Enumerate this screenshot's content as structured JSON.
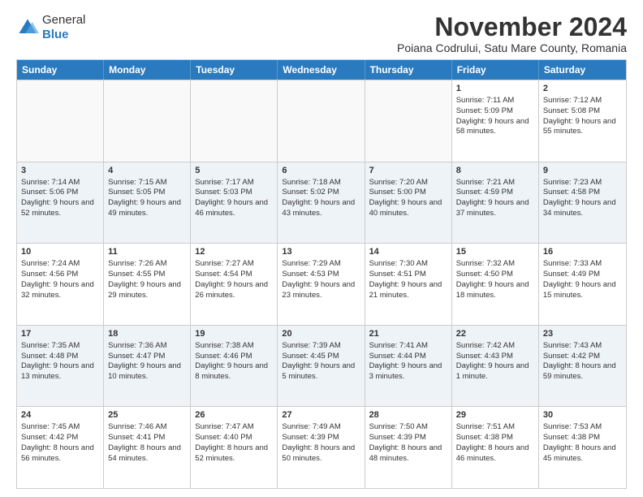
{
  "logo": {
    "general": "General",
    "blue": "Blue"
  },
  "title": "November 2024",
  "subtitle": "Poiana Codrului, Satu Mare County, Romania",
  "headers": [
    "Sunday",
    "Monday",
    "Tuesday",
    "Wednesday",
    "Thursday",
    "Friday",
    "Saturday"
  ],
  "weeks": [
    [
      {
        "day": "",
        "content": ""
      },
      {
        "day": "",
        "content": ""
      },
      {
        "day": "",
        "content": ""
      },
      {
        "day": "",
        "content": ""
      },
      {
        "day": "",
        "content": ""
      },
      {
        "day": "1",
        "content": "Sunrise: 7:11 AM\nSunset: 5:09 PM\nDaylight: 9 hours and 58 minutes."
      },
      {
        "day": "2",
        "content": "Sunrise: 7:12 AM\nSunset: 5:08 PM\nDaylight: 9 hours and 55 minutes."
      }
    ],
    [
      {
        "day": "3",
        "content": "Sunrise: 7:14 AM\nSunset: 5:06 PM\nDaylight: 9 hours and 52 minutes."
      },
      {
        "day": "4",
        "content": "Sunrise: 7:15 AM\nSunset: 5:05 PM\nDaylight: 9 hours and 49 minutes."
      },
      {
        "day": "5",
        "content": "Sunrise: 7:17 AM\nSunset: 5:03 PM\nDaylight: 9 hours and 46 minutes."
      },
      {
        "day": "6",
        "content": "Sunrise: 7:18 AM\nSunset: 5:02 PM\nDaylight: 9 hours and 43 minutes."
      },
      {
        "day": "7",
        "content": "Sunrise: 7:20 AM\nSunset: 5:00 PM\nDaylight: 9 hours and 40 minutes."
      },
      {
        "day": "8",
        "content": "Sunrise: 7:21 AM\nSunset: 4:59 PM\nDaylight: 9 hours and 37 minutes."
      },
      {
        "day": "9",
        "content": "Sunrise: 7:23 AM\nSunset: 4:58 PM\nDaylight: 9 hours and 34 minutes."
      }
    ],
    [
      {
        "day": "10",
        "content": "Sunrise: 7:24 AM\nSunset: 4:56 PM\nDaylight: 9 hours and 32 minutes."
      },
      {
        "day": "11",
        "content": "Sunrise: 7:26 AM\nSunset: 4:55 PM\nDaylight: 9 hours and 29 minutes."
      },
      {
        "day": "12",
        "content": "Sunrise: 7:27 AM\nSunset: 4:54 PM\nDaylight: 9 hours and 26 minutes."
      },
      {
        "day": "13",
        "content": "Sunrise: 7:29 AM\nSunset: 4:53 PM\nDaylight: 9 hours and 23 minutes."
      },
      {
        "day": "14",
        "content": "Sunrise: 7:30 AM\nSunset: 4:51 PM\nDaylight: 9 hours and 21 minutes."
      },
      {
        "day": "15",
        "content": "Sunrise: 7:32 AM\nSunset: 4:50 PM\nDaylight: 9 hours and 18 minutes."
      },
      {
        "day": "16",
        "content": "Sunrise: 7:33 AM\nSunset: 4:49 PM\nDaylight: 9 hours and 15 minutes."
      }
    ],
    [
      {
        "day": "17",
        "content": "Sunrise: 7:35 AM\nSunset: 4:48 PM\nDaylight: 9 hours and 13 minutes."
      },
      {
        "day": "18",
        "content": "Sunrise: 7:36 AM\nSunset: 4:47 PM\nDaylight: 9 hours and 10 minutes."
      },
      {
        "day": "19",
        "content": "Sunrise: 7:38 AM\nSunset: 4:46 PM\nDaylight: 9 hours and 8 minutes."
      },
      {
        "day": "20",
        "content": "Sunrise: 7:39 AM\nSunset: 4:45 PM\nDaylight: 9 hours and 5 minutes."
      },
      {
        "day": "21",
        "content": "Sunrise: 7:41 AM\nSunset: 4:44 PM\nDaylight: 9 hours and 3 minutes."
      },
      {
        "day": "22",
        "content": "Sunrise: 7:42 AM\nSunset: 4:43 PM\nDaylight: 9 hours and 1 minute."
      },
      {
        "day": "23",
        "content": "Sunrise: 7:43 AM\nSunset: 4:42 PM\nDaylight: 8 hours and 59 minutes."
      }
    ],
    [
      {
        "day": "24",
        "content": "Sunrise: 7:45 AM\nSunset: 4:42 PM\nDaylight: 8 hours and 56 minutes."
      },
      {
        "day": "25",
        "content": "Sunrise: 7:46 AM\nSunset: 4:41 PM\nDaylight: 8 hours and 54 minutes."
      },
      {
        "day": "26",
        "content": "Sunrise: 7:47 AM\nSunset: 4:40 PM\nDaylight: 8 hours and 52 minutes."
      },
      {
        "day": "27",
        "content": "Sunrise: 7:49 AM\nSunset: 4:39 PM\nDaylight: 8 hours and 50 minutes."
      },
      {
        "day": "28",
        "content": "Sunrise: 7:50 AM\nSunset: 4:39 PM\nDaylight: 8 hours and 48 minutes."
      },
      {
        "day": "29",
        "content": "Sunrise: 7:51 AM\nSunset: 4:38 PM\nDaylight: 8 hours and 46 minutes."
      },
      {
        "day": "30",
        "content": "Sunrise: 7:53 AM\nSunset: 4:38 PM\nDaylight: 8 hours and 45 minutes."
      }
    ]
  ]
}
